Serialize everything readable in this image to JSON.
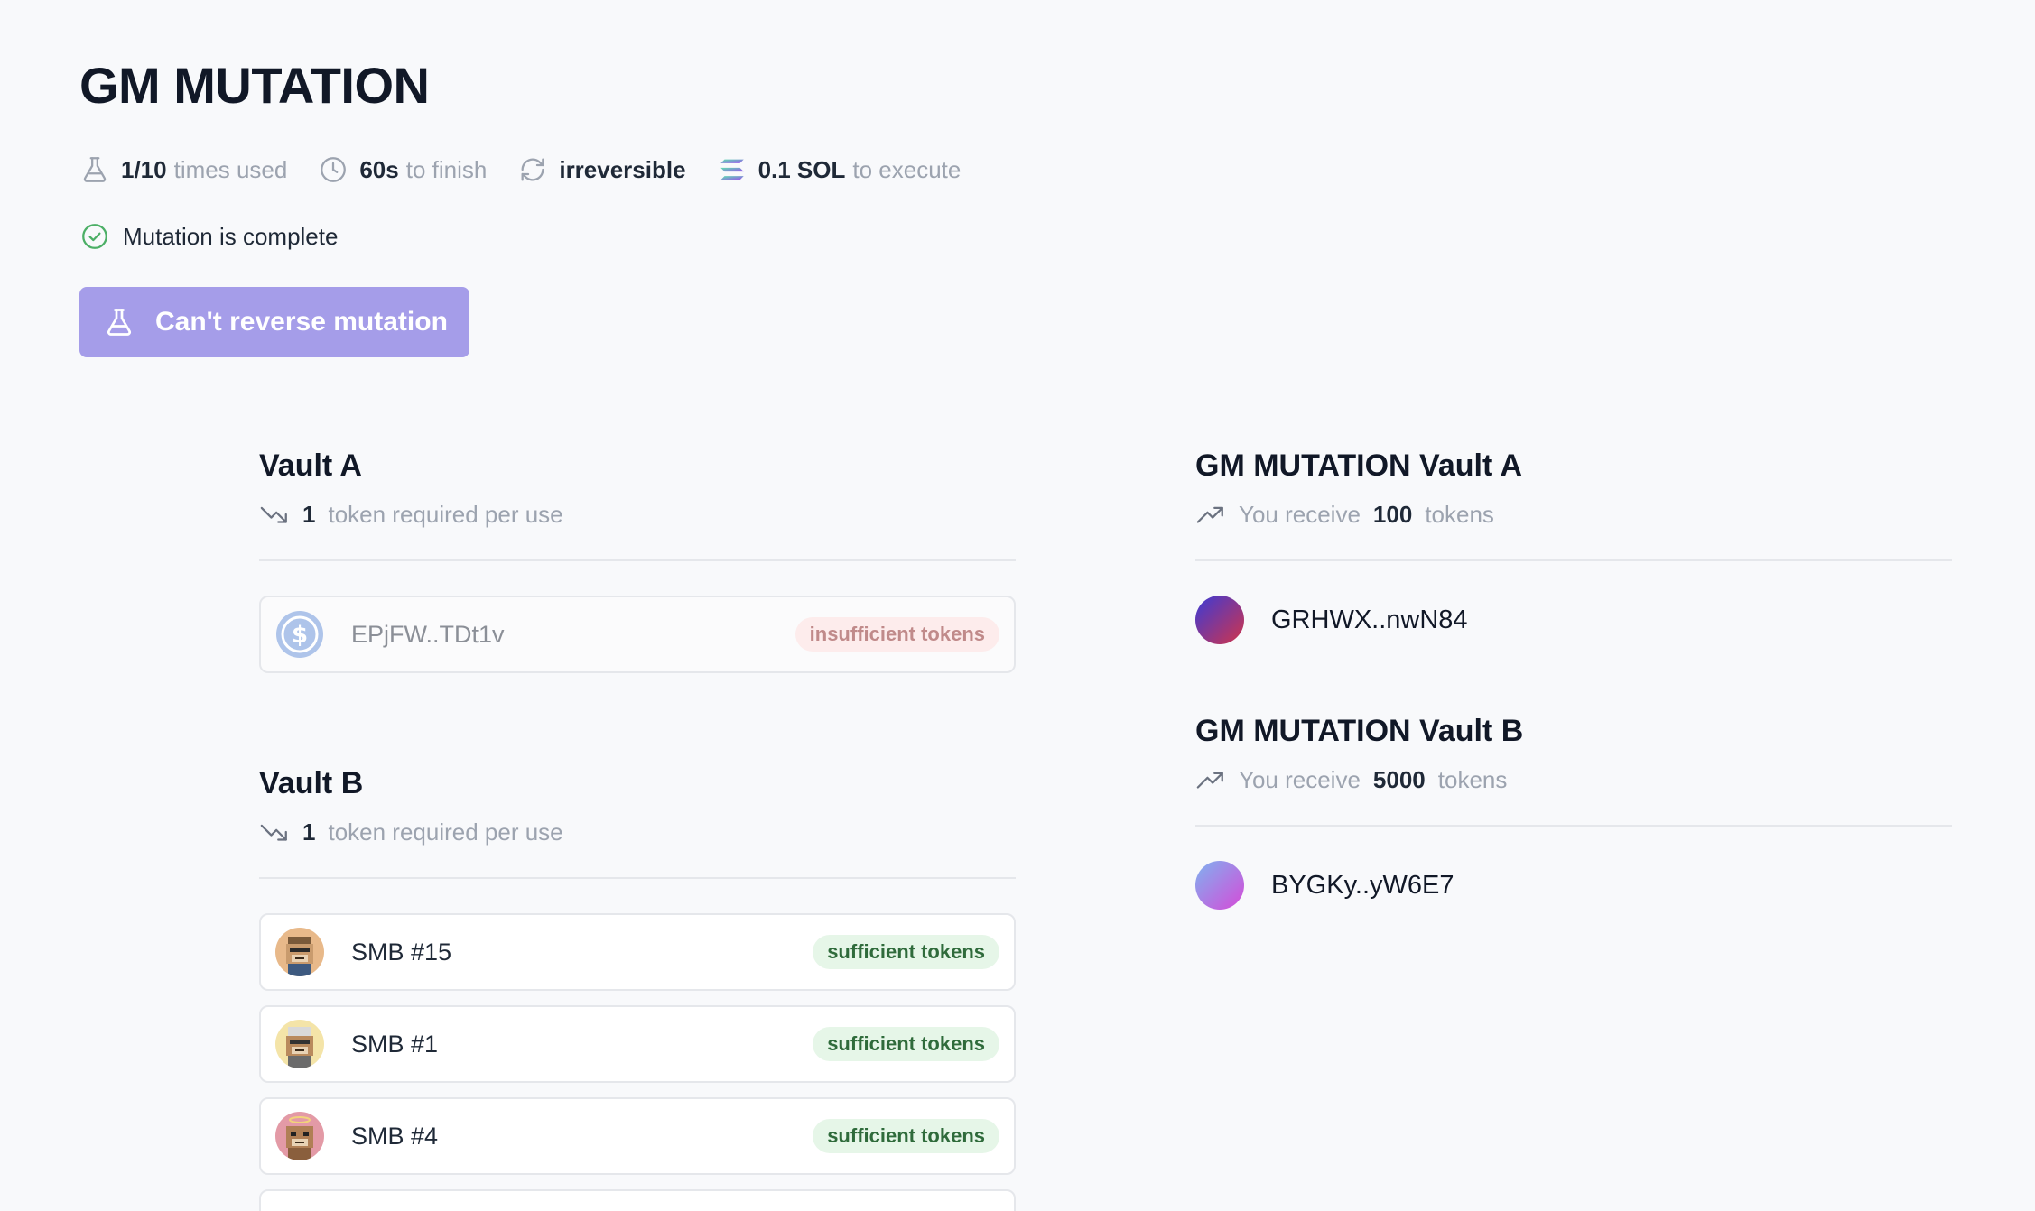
{
  "header": {
    "title": "GM MUTATION"
  },
  "meta": {
    "uses_value": "1/10",
    "uses_text": "times used",
    "duration_value": "60s",
    "duration_text": "to finish",
    "reversibility": "irreversible",
    "cost_value": "0.1 SOL",
    "cost_text": "to execute"
  },
  "status": {
    "text": "Mutation is complete"
  },
  "action": {
    "label": "Can't reverse mutation"
  },
  "inputs": [
    {
      "title": "Vault A",
      "required_count": "1",
      "required_text": "token required per use",
      "tokens": [
        {
          "name": "EPjFW..TDt1v",
          "badge": "insufficient tokens",
          "icon": "usdc-coin-icon"
        }
      ]
    },
    {
      "title": "Vault B",
      "required_count": "1",
      "required_text": "token required per use",
      "tokens": [
        {
          "name": "SMB #15",
          "badge": "sufficient tokens",
          "icon": "monkey-nft-avatar"
        },
        {
          "name": "SMB #1",
          "badge": "sufficient tokens",
          "icon": "monkey-nft-avatar"
        },
        {
          "name": "SMB #4",
          "badge": "sufficient tokens",
          "icon": "monkey-nft-avatar"
        }
      ]
    }
  ],
  "outputs": [
    {
      "title": "GM MUTATION Vault A",
      "receive_prefix": "You receive",
      "receive_amount": "100",
      "receive_suffix": "tokens",
      "token": "GRHWX..nwN84",
      "gradient": [
        "#3b3bd6",
        "#d2344a"
      ]
    },
    {
      "title": "GM MUTATION Vault B",
      "receive_prefix": "You receive",
      "receive_amount": "5000",
      "receive_suffix": "tokens",
      "token": "BYGKy..yW6E7",
      "gradient": [
        "#7fb2f0",
        "#d64ad8"
      ]
    }
  ],
  "colors": {
    "accent": "#a59de9",
    "success": "#4caf66",
    "badge_good_bg": "#e6f6e8",
    "badge_bad_bg": "#fdecec"
  }
}
